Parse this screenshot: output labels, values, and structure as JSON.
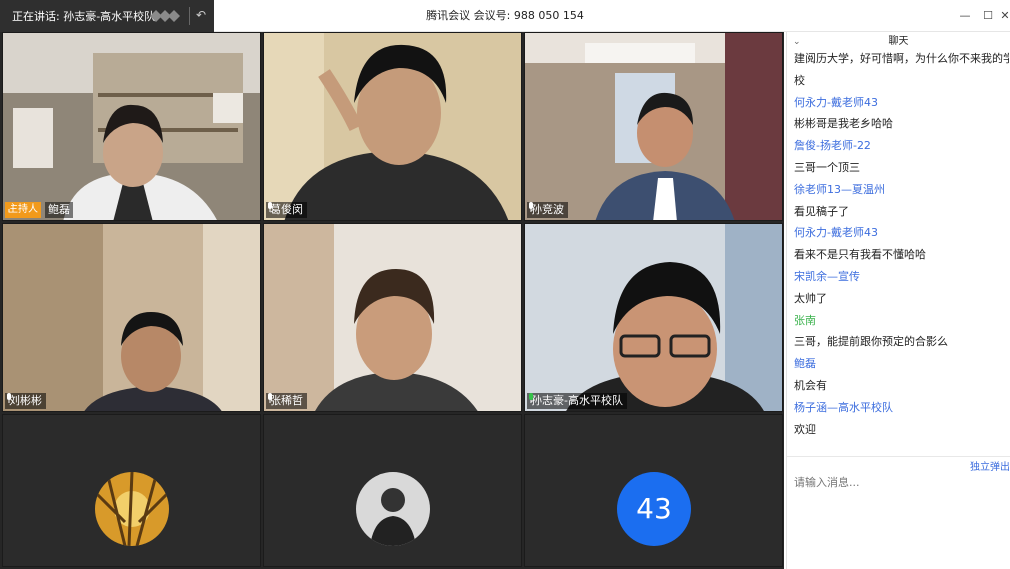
{
  "speaking_bar": {
    "label": "正在讲话: 孙志豪-高水平校队;"
  },
  "window": {
    "title": "腾讯会议 会议号: 988 050 154",
    "controls": {
      "minimize": "—",
      "maximize": "☐",
      "close": "✕"
    }
  },
  "participants": [
    {
      "name": "鲍磊",
      "host_label": "主持人"
    },
    {
      "name": "葛俊闵"
    },
    {
      "name": "孙竞波"
    },
    {
      "name": "刘彬彬"
    },
    {
      "name": "张稀哲"
    },
    {
      "name": "孙志豪-高水平校队"
    }
  ],
  "avatars": {
    "third_number": "43"
  },
  "chat": {
    "title": "聊天",
    "popout_label": "独立弹出",
    "input_placeholder": "请输入消息...",
    "lines": [
      {
        "kind": "text",
        "value": "建阅历大学，好可惜啊，为什么你不来我的学"
      },
      {
        "kind": "text",
        "value": "校"
      },
      {
        "kind": "sender",
        "value": "何永力-戴老师43"
      },
      {
        "kind": "text",
        "value": "彬彬哥是我老乡哈哈"
      },
      {
        "kind": "sender",
        "value": "詹俊-扬老师-22"
      },
      {
        "kind": "text",
        "value": "三哥一个顶三"
      },
      {
        "kind": "sender",
        "value": "徐老师13—夏温州"
      },
      {
        "kind": "text",
        "value": "看见稿子了"
      },
      {
        "kind": "sender",
        "value": "何永力-戴老师43"
      },
      {
        "kind": "text",
        "value": "看来不是只有我看不懂哈哈"
      },
      {
        "kind": "sender",
        "value": "宋凯余—宣传"
      },
      {
        "kind": "text",
        "value": "太帅了"
      },
      {
        "kind": "sender_green",
        "value": "张南"
      },
      {
        "kind": "text",
        "value": "三哥，能提前跟你预定的合影么"
      },
      {
        "kind": "sender",
        "value": "鲍磊"
      },
      {
        "kind": "text",
        "value": "机会有"
      },
      {
        "kind": "sender",
        "value": "杨子涵—高水平校队"
      },
      {
        "kind": "text",
        "value": "欢迎"
      }
    ]
  }
}
